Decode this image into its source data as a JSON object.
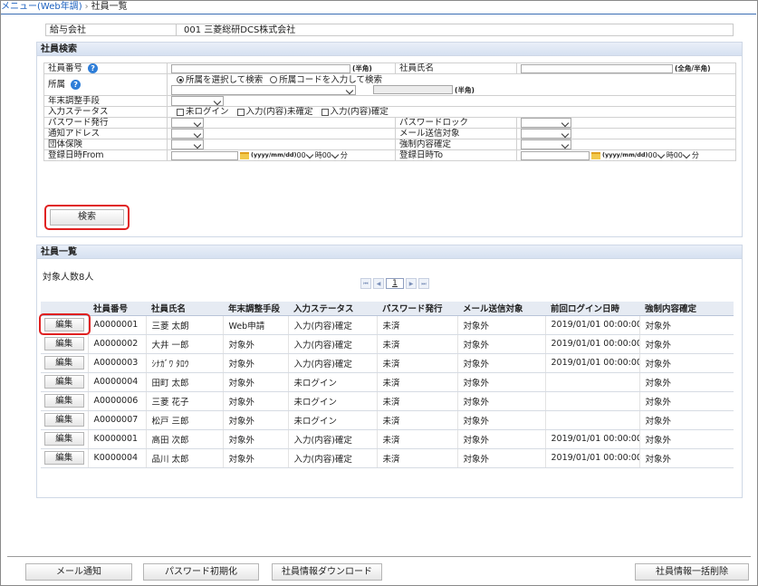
{
  "breadcrumb": {
    "menu_link": "メニュー(Web年調)",
    "current": "社員一覧"
  },
  "company": {
    "label": "給与会社",
    "value": "001 三菱総研DCS株式会社"
  },
  "search": {
    "title": "社員検索",
    "emp_no_label": "社員番号",
    "emp_no_hint": "(半角)",
    "emp_name_label": "社員氏名",
    "emp_name_hint": "(全角/半角)",
    "dept_label": "所属",
    "dept_radio_select": "所属を選択して検索",
    "dept_radio_code": "所属コードを入力して検索",
    "dept_code_hint": "(半角)",
    "adjust_method_label": "年末調整手段",
    "input_status_label": "入力ステータス",
    "status_not_logged": "未ログイン",
    "status_unconfirmed": "入力(内容)未確定",
    "status_confirmed": "入力(内容)確定",
    "password_issue_label": "パスワード発行",
    "password_lock_label": "パスワードロック",
    "notify_address_label": "通知アドレス",
    "mail_target_label": "メール送信対象",
    "group_insurance_label": "団体保険",
    "force_confirm_label": "強制内容確定",
    "reg_from_label": "登録日時From",
    "reg_to_label": "登録日時To",
    "date_hint": "(yyyy/mm/dd)",
    "hour_value": "00",
    "hour_unit": "時",
    "minute_value": "00",
    "minute_unit": "分",
    "search_button": "検索"
  },
  "list": {
    "title": "社員一覧",
    "count_text": "対象人数8人",
    "pager": {
      "first": "⏮",
      "prev": "◀",
      "current": "1",
      "next": "▶",
      "last": "⏭"
    },
    "edit_label": "編集",
    "headers": [
      "",
      "社員番号",
      "社員氏名",
      "年末調整手段",
      "入力ステータス",
      "パスワード発行",
      "メール送信対象",
      "前回ログイン日時",
      "強制内容確定"
    ],
    "rows": [
      {
        "no": "A0000001",
        "name": "三菱 太朗",
        "method": "Web申請",
        "status": "入力(内容)確定",
        "pw": "未済",
        "mail": "対象外",
        "last_login": "2019/01/01 00:00:00",
        "force": "対象外"
      },
      {
        "no": "A0000002",
        "name": "大井 一郎",
        "method": "対象外",
        "status": "入力(内容)確定",
        "pw": "未済",
        "mail": "対象外",
        "last_login": "2019/01/01 00:00:00",
        "force": "対象外"
      },
      {
        "no": "A0000003",
        "name": "ｼﾅｶﾞﾜ ﾀﾛｳ",
        "method": "対象外",
        "status": "入力(内容)確定",
        "pw": "未済",
        "mail": "対象外",
        "last_login": "2019/01/01 00:00:00",
        "force": "対象外"
      },
      {
        "no": "A0000004",
        "name": "田町 太郎",
        "method": "対象外",
        "status": "未ログイン",
        "pw": "未済",
        "mail": "対象外",
        "last_login": "",
        "force": "対象外"
      },
      {
        "no": "A0000006",
        "name": "三菱 花子",
        "method": "対象外",
        "status": "未ログイン",
        "pw": "未済",
        "mail": "対象外",
        "last_login": "",
        "force": "対象外"
      },
      {
        "no": "A0000007",
        "name": "松戸 三郎",
        "method": "対象外",
        "status": "未ログイン",
        "pw": "未済",
        "mail": "対象外",
        "last_login": "",
        "force": "対象外"
      },
      {
        "no": "K0000001",
        "name": "高田 次郎",
        "method": "対象外",
        "status": "入力(内容)確定",
        "pw": "未済",
        "mail": "対象外",
        "last_login": "2019/01/01 00:00:00",
        "force": "対象外"
      },
      {
        "no": "K0000004",
        "name": "品川 太郎",
        "method": "対象外",
        "status": "入力(内容)確定",
        "pw": "未済",
        "mail": "対象外",
        "last_login": "2019/01/01 00:00:00",
        "force": "対象外"
      }
    ]
  },
  "footer": {
    "mail_notify": "メール通知",
    "password_reset": "パスワード初期化",
    "download": "社員情報ダウンロード",
    "bulk_delete": "社員情報一括削除"
  },
  "colors": {
    "highlight": "#e02020",
    "link": "#1a5fbf",
    "help_icon": "#2f7ed8",
    "header_bg": "#e6ebf3"
  }
}
